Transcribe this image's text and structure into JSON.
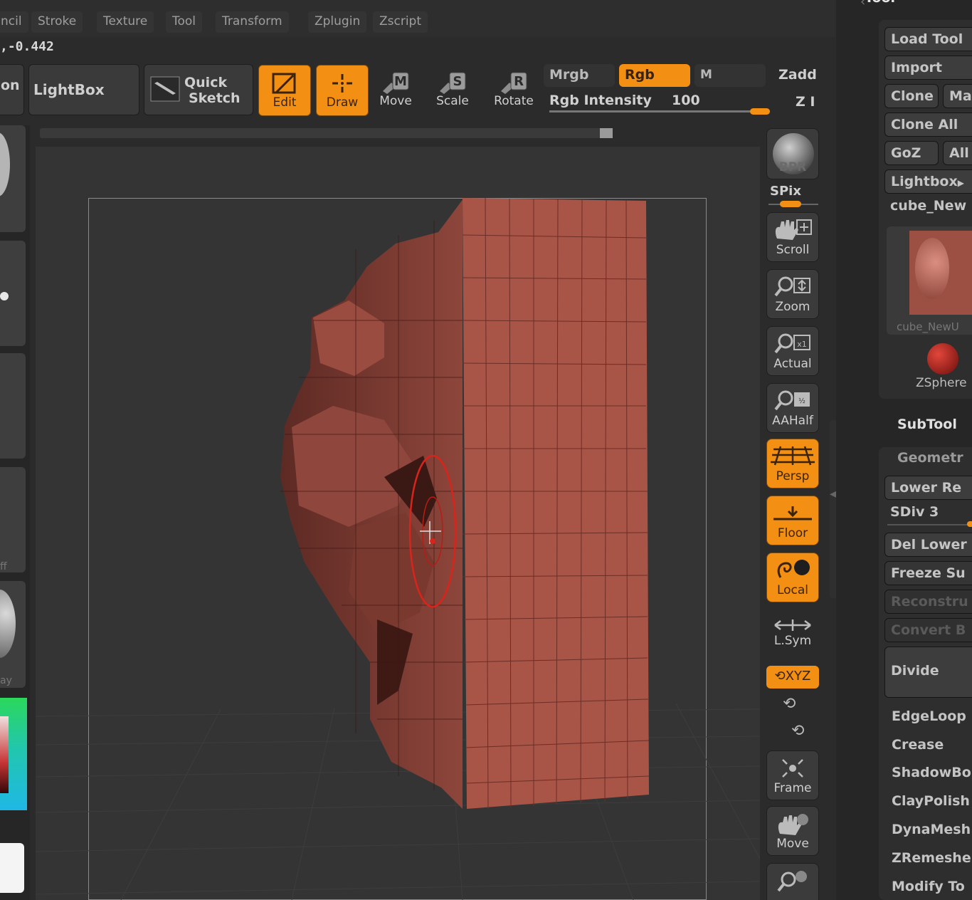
{
  "menu": [
    "ncil",
    "Stroke",
    "Texture",
    "Tool",
    "Transform",
    "Zplugin",
    "Zscript"
  ],
  "coords": ",-0.442",
  "toolbar": {
    "partial_left": "on",
    "lightbox": "LightBox",
    "quick_sketch_line1": "Quick",
    "quick_sketch_line2": "Sketch",
    "edit": "Edit",
    "draw": "Draw",
    "move": "Move",
    "scale": "Scale",
    "rotate": "Rotate",
    "move_key": "M",
    "scale_key": "S",
    "rotate_key": "R"
  },
  "color_modes": {
    "mrgb": "Mrgb",
    "rgb": "Rgb",
    "m": "M",
    "zadd": "Zadd",
    "rgb_intensity_label": "Rgb Intensity",
    "rgb_intensity_value": "100",
    "z_partial": "Z I",
    "rgb_intensity_fraction": 1.0
  },
  "left_shelf": {
    "ff": "ff",
    "ay": "ay"
  },
  "right_shelf": {
    "bpr": "BPR",
    "spix": "SPix",
    "scroll": "Scroll",
    "zoom": "Zoom",
    "actual": "Actual",
    "aahalf": "AAHalf",
    "persp": "Persp",
    "floor": "Floor",
    "local": "Local",
    "lsym": "L.Sym",
    "xyz": "XYZ",
    "frame": "Frame",
    "move": "Move"
  },
  "palette": {
    "header": "Tool",
    "load_tool": "Load Tool",
    "import": "Import",
    "clone": "Clone",
    "make": "Mak",
    "clone_all": "Clone All",
    "goz": "GoZ",
    "all": "All",
    "lightbox": "Lightbox",
    "tool_name": "cube_New",
    "thumb_label": "cube_NewU",
    "zsphere": "ZSphere",
    "subtool": "SubTool",
    "geometry": "Geometr",
    "lower_res": "Lower Re",
    "sdiv": "SDiv 3",
    "del_lower": "Del Lower",
    "freeze_sub": "Freeze Su",
    "reconstruct": "Reconstru",
    "convert": "Convert B",
    "divide": "Divide",
    "edgeloop": "EdgeLoop",
    "crease": "Crease",
    "shadowbox": "ShadowBo",
    "claypolish": "ClayPolish",
    "dynamesh": "DynaMesh",
    "zremesher": "ZRemeshe",
    "modify_topo": "Modify To"
  },
  "colors": {
    "accent": "#f39013",
    "mesh": "#a85447",
    "background": "#2b2b2b"
  }
}
